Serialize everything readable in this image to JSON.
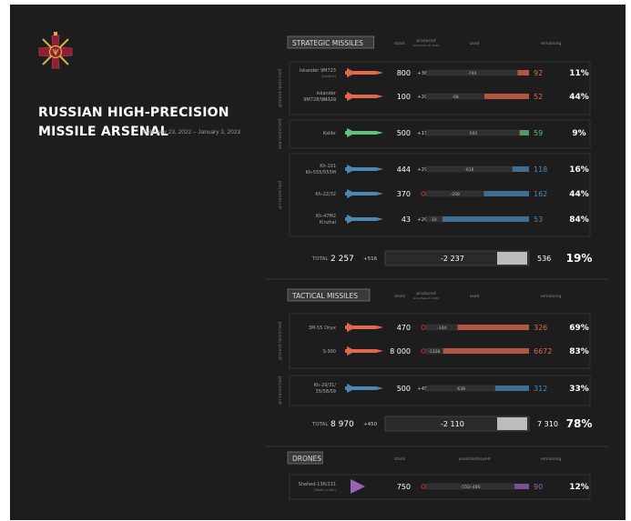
{
  "header": {
    "title_line1": "RUSSIAN HIGH-PRECISION",
    "title_line2": "MISSILE ARSENAL",
    "dates": "February 23, 2022 – January 3, 2023",
    "emblem_icon": "ukraine-armed-forces-cross-emblem-icon"
  },
  "colors": {
    "background": "#1d1d1d",
    "ground": "#e2694f",
    "sea": "#63c27a",
    "air": "#4d88b5",
    "drone": "#9a63b8",
    "panel_border": "#3a3a3a",
    "text": "#ffffff",
    "muted": "#8a8a8a"
  },
  "columns": {
    "stock": "stock",
    "produced": "produced",
    "produced_sub": "since Feb 23, 2022",
    "used": "used",
    "used_destroyed": "used/destroyed",
    "remaining": "remaining"
  },
  "chart_data": [
    {
      "type": "table",
      "section": "STRATEGIC MISSILES",
      "groups": [
        {
          "label": "ground-launched",
          "rows": [
            {
              "name": "Iskander 9M723",
              "sub": "(ballistic)",
              "color": "ground",
              "stock": 800,
              "produced": "+36",
              "used": "-744",
              "remaining": 92,
              "percent": "11%"
            },
            {
              "name": "Iskander 9M728/9M729",
              "sub": "(winged)",
              "color": "ground",
              "stock": 100,
              "produced": "+20",
              "used": "-68",
              "remaining": 52,
              "percent": "44%"
            }
          ]
        },
        {
          "label": "sea-launched",
          "rows": [
            {
              "name": "Kalibr",
              "sub": "",
              "color": "sea",
              "stock": 500,
              "produced": "+150",
              "used": "-591",
              "remaining": 59,
              "percent": "9%"
            }
          ]
        },
        {
          "label": "air-launched",
          "rows": [
            {
              "name": "Kh-101 Kh-555/555M",
              "sub": "",
              "color": "air",
              "stock": 444,
              "produced": "+290",
              "used": "-616",
              "remaining": 118,
              "percent": "16%"
            },
            {
              "name": "Kh-22/32",
              "sub": "",
              "color": "air",
              "stock": 370,
              "produced": "",
              "used": "-208",
              "remaining": 162,
              "percent": "44%"
            },
            {
              "name": "Kh-47M2 Kinzhal",
              "sub": "",
              "color": "air",
              "stock": 43,
              "produced": "+20",
              "used": "-10",
              "remaining": 53,
              "percent": "84%"
            }
          ]
        }
      ],
      "total": {
        "label": "TOTAL",
        "stock": "2 257",
        "produced": "+516",
        "used": "-2 237",
        "remaining": 536,
        "percent": "19%"
      }
    },
    {
      "type": "table",
      "section": "TACTICAL MISSILES",
      "groups": [
        {
          "label": "ground-launched",
          "rows": [
            {
              "name": "3M-55 Onyx",
              "sub": "",
              "color": "ground",
              "stock": 470,
              "produced": "",
              "used": "-144",
              "remaining": 326,
              "percent": "69%"
            },
            {
              "name": "S-300",
              "sub": "",
              "color": "ground",
              "stock": "8 000",
              "produced": "",
              "used": "-1328",
              "remaining": 6672,
              "percent": "83%"
            }
          ]
        },
        {
          "label": "air-launched",
          "rows": [
            {
              "name": "Kh-29/31/ 35/58/59",
              "sub": "",
              "color": "air",
              "stock": 500,
              "produced": "+450",
              "used": "-638",
              "remaining": 312,
              "percent": "33%"
            }
          ]
        }
      ],
      "total": {
        "label": "TOTAL",
        "stock": "8 970",
        "produced": "+450",
        "used": "-2 110",
        "remaining": "7 310",
        "percent": "78%"
      }
    },
    {
      "type": "table",
      "section": "DRONES",
      "groups": [
        {
          "label": "",
          "rows": [
            {
              "name": "Shahed-136/131",
              "sub": "(Made in Iran)",
              "color": "drone",
              "stock": 750,
              "produced": "",
              "used": "-550/-486",
              "remaining": 90,
              "percent": "12%"
            }
          ]
        }
      ]
    }
  ]
}
